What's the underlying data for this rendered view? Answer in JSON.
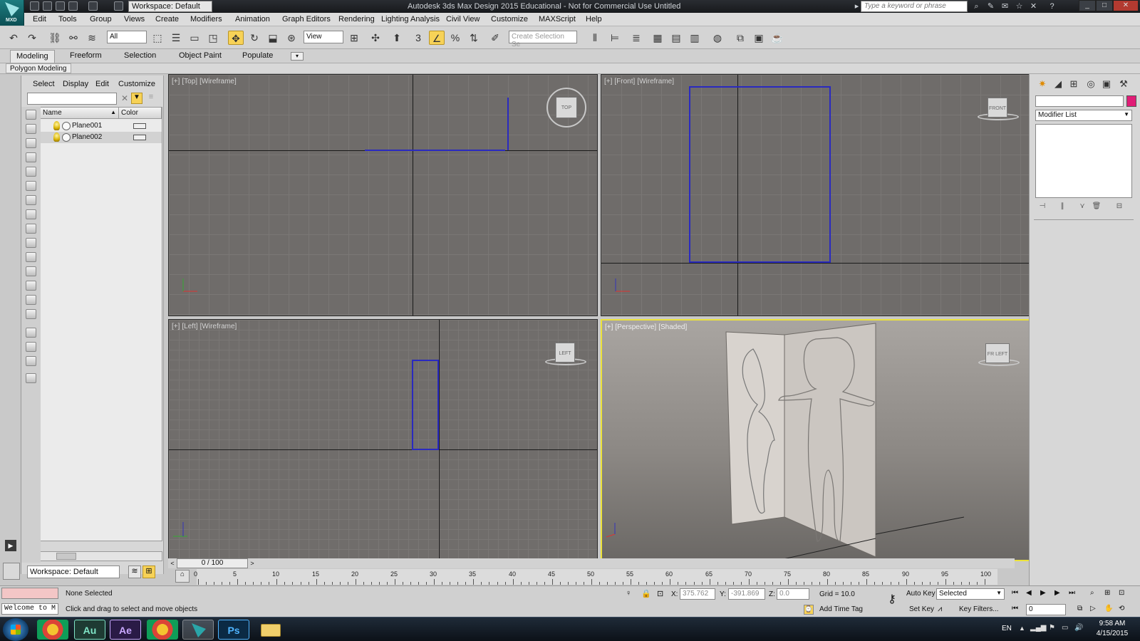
{
  "titlebar": {
    "title": "Autodesk 3ds Max Design 2015  Educational - Not for Commercial Use   Untitled",
    "workspace": "Workspace: Default",
    "search_placeholder": "Type a keyword or phrase",
    "app_label": "MXD"
  },
  "menu": [
    "Edit",
    "Tools",
    "Group",
    "Views",
    "Create",
    "Modifiers",
    "Animation",
    "Graph Editors",
    "Rendering",
    "Lighting Analysis",
    "Civil View",
    "Customize",
    "MAXScript",
    "Help"
  ],
  "toolbar": {
    "filter": "All",
    "refcoord": "View",
    "selection_set_placeholder": "Create Selection Se",
    "snap_label": "3"
  },
  "ribbon": {
    "tabs": [
      "Modeling",
      "Freeform",
      "Selection",
      "Object Paint",
      "Populate"
    ],
    "active_tab": "Modeling",
    "subtab": "Polygon Modeling"
  },
  "explorer": {
    "menu": [
      "Select",
      "Display",
      "Edit",
      "Customize"
    ],
    "col_name": "Name",
    "col_color": "Color",
    "items": [
      {
        "name": "Plane001"
      },
      {
        "name": "Plane002"
      }
    ],
    "workspace": "Workspace: Default"
  },
  "viewports": {
    "top": [
      "[+]",
      "[Top]",
      "[Wireframe]"
    ],
    "front": [
      "[+]",
      "[Front]",
      "[Wireframe]"
    ],
    "left": [
      "[+]",
      "[Left]",
      "[Wireframe]"
    ],
    "persp": [
      "[+]",
      "[Perspective]",
      "[Shaded]"
    ],
    "cube_top": "TOP",
    "cube_front": "FRONT",
    "cube_left": "LEFT",
    "cube_persp": "FR   LEFT"
  },
  "timeline": {
    "slider": "0 / 100",
    "ticks": [
      "0",
      "5",
      "10",
      "15",
      "20",
      "25",
      "30",
      "35",
      "40",
      "45",
      "50",
      "55",
      "60",
      "65",
      "70",
      "75",
      "80",
      "85",
      "90",
      "95",
      "100"
    ]
  },
  "command_panel": {
    "modifier_list": "Modifier List",
    "accent_color": "#e01d77"
  },
  "status": {
    "maxscript": "Welcome to M",
    "selection": "None Selected",
    "prompt": "Click and drag to select and move objects",
    "x_label": "X:",
    "x": "375.762",
    "y_label": "Y:",
    "y": "-391.869",
    "z_label": "Z:",
    "z": "0.0",
    "grid": "Grid = 10.0",
    "add_time_tag": "Add Time Tag",
    "auto_key": "Auto Key",
    "set_key": "Set Key",
    "selected": "Selected",
    "key_filters": "Key Filters...",
    "frame": "0"
  },
  "taskbar": {
    "apps": [
      "Au",
      "Ae",
      "Ps"
    ],
    "lang": "EN",
    "time": "9:58 AM",
    "date": "4/15/2015"
  }
}
